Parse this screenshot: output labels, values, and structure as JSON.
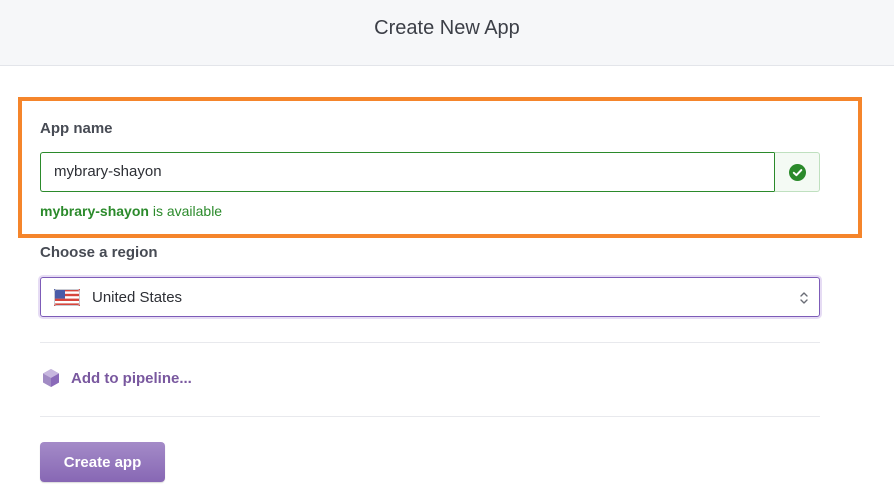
{
  "header": {
    "title": "Create New App"
  },
  "app_name": {
    "label": "App name",
    "value": "mybrary-shayon",
    "status_icon": "check-circle-icon",
    "availability_name": "mybrary-shayon",
    "availability_suffix": " is available"
  },
  "region": {
    "label": "Choose a region",
    "selected": "United States",
    "flag_icon": "us-flag-icon",
    "arrows_icon": "select-arrows-icon"
  },
  "pipeline": {
    "label": "Add to pipeline...",
    "icon": "pipeline-hexagon-icon"
  },
  "actions": {
    "create_label": "Create app"
  },
  "colors": {
    "highlight": "#f5852b",
    "success": "#2b8a2b",
    "accent": "#79589f",
    "button": "#8767b4"
  }
}
